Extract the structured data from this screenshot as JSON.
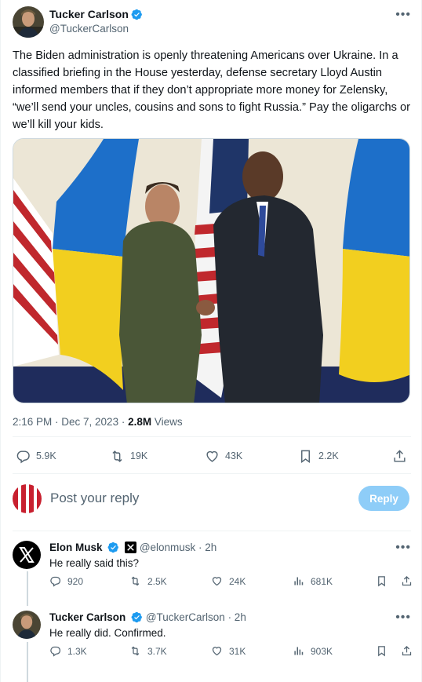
{
  "post": {
    "author_name": "Tucker Carlson",
    "author_handle": "@TuckerCarlson",
    "more_label": "•••",
    "text": "The Biden administration is openly threatening Americans over Ukraine. In a classified briefing in the House yesterday, defense secretary Lloyd Austin informed members that if they don’t appropriate more money for Zelensky, “we’ll send your uncles, cousins and sons to fight Russia.” Pay the oligarchs or we’ll kill your kids.",
    "timestamp": "2:16 PM · Dec 7, 2023 · ",
    "views_count": "2.8M",
    "views_label": " Views",
    "stats": {
      "replies": "5.9K",
      "reposts": "19K",
      "likes": "43K",
      "bookmarks": "2.2K"
    }
  },
  "reply_box": {
    "placeholder": "Post your reply",
    "button": "Reply"
  },
  "replies": [
    {
      "author_name": "Elon Musk",
      "author_handle": "@elonmusk",
      "time": " · 2h",
      "text": "He really said this?",
      "stats": {
        "replies": "920",
        "reposts": "2.5K",
        "likes": "24K",
        "views": "681K"
      }
    },
    {
      "author_name": "Tucker Carlson",
      "author_handle": "@TuckerCarlson",
      "time": " · 2h",
      "text": "He really did. Confirmed.",
      "stats": {
        "replies": "1.3K",
        "reposts": "3.7K",
        "likes": "31K",
        "views": "903K"
      }
    }
  ],
  "colors": {
    "accent": "#1d9bf0",
    "text_secondary": "#536471",
    "reply_button": "#8ecdf8"
  }
}
